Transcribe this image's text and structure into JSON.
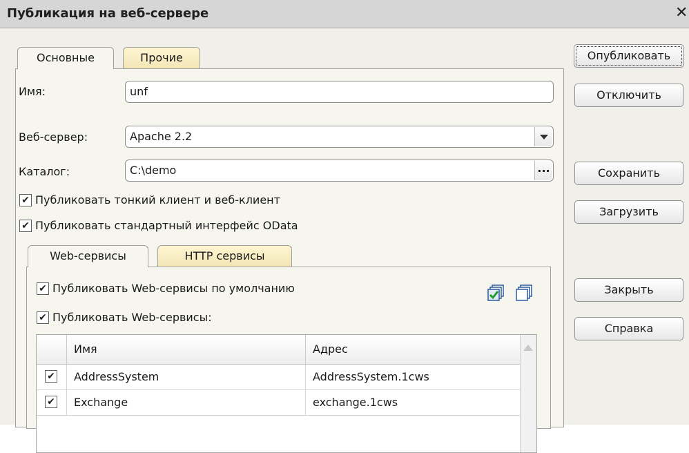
{
  "window": {
    "title": "Публикация на веб-сервере"
  },
  "tabs": [
    {
      "label": "Основные",
      "active": true
    },
    {
      "label": "Прочие",
      "active": false
    }
  ],
  "form": {
    "name_label": "Имя:",
    "name_value": "unf",
    "webserver_label": "Веб-сервер:",
    "webserver_value": "Apache 2.2",
    "directory_label": "Каталог:",
    "directory_value": "C:\\demo",
    "browse_label": "..."
  },
  "options": {
    "thin_client": {
      "label": "Публиковать тонкий клиент и веб-клиент",
      "checked": true
    },
    "odata": {
      "label": "Публиковать стандартный интерфейс OData",
      "checked": true
    }
  },
  "services_tabs": [
    {
      "label": "Web-сервисы",
      "active": true
    },
    {
      "label": "HTTP сервисы",
      "active": false
    }
  ],
  "services": {
    "default_option": {
      "label": "Публиковать Web-сервисы по умолчанию",
      "checked": true
    },
    "publish_option": {
      "label": "Публиковать Web-сервисы:",
      "checked": true
    },
    "icons": [
      "check-all-icon",
      "uncheck-all-icon"
    ],
    "columns": [
      "Имя",
      "Адрес"
    ],
    "rows": [
      {
        "checked": true,
        "name": "AddressSystem",
        "address": "AddressSystem.1cws"
      },
      {
        "checked": true,
        "name": "Exchange",
        "address": "exchange.1cws"
      }
    ]
  },
  "buttons": {
    "publish": "Опубликовать",
    "disable": "Отключить",
    "save": "Сохранить",
    "load": "Загрузить",
    "close": "Закрыть",
    "help": "Справка"
  },
  "colors": {
    "dialog_bg": "#f0efe9",
    "titlebar_bg": "#d6d6d6",
    "inactive_tab_bg": "#f2e6b6"
  }
}
